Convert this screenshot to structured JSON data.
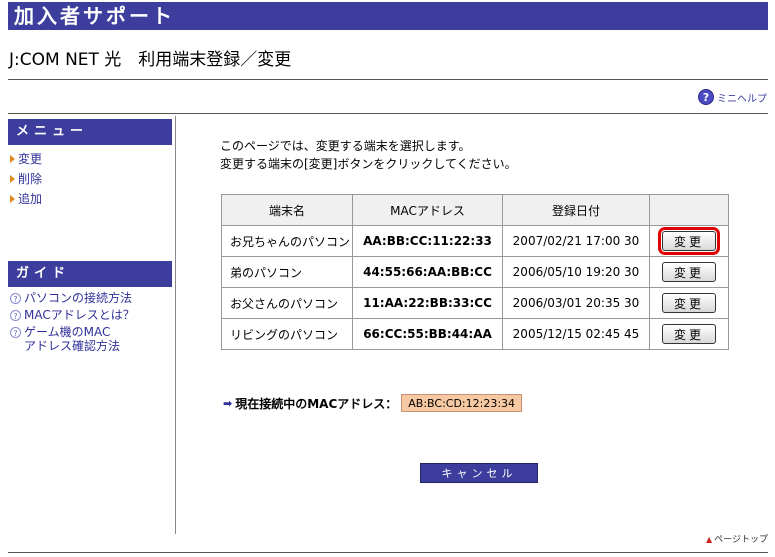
{
  "header": {
    "title": "加入者サポート"
  },
  "page_title": "J:COM NET 光　利用端末登録／変更",
  "mini_help": {
    "label": "ミニヘルプ"
  },
  "sidebar": {
    "menu_title": "メニュー",
    "menu_items": [
      "変更",
      "削除",
      "追加"
    ],
    "guide_title": "ガイド",
    "guide_items": [
      "パソコンの接続方法",
      "MACアドレスとは？",
      "ゲーム機のMAC\nアドレス確認方法"
    ]
  },
  "intro": {
    "line1": "このページでは、変更する端末を選択します。",
    "line2": "変更する端末の[変更]ボタンをクリックしてください。"
  },
  "table": {
    "headers": [
      "端末名",
      "MACアドレス",
      "登録日付",
      ""
    ],
    "rows": [
      {
        "name": "お兄ちゃんのパソコン",
        "mac": "AA:BB:CC:11:22:33",
        "date": "2007/02/21 17:00 30",
        "action": "変更"
      },
      {
        "name": "弟のパソコン",
        "mac": "44:55:66:AA:BB:CC",
        "date": "2006/05/10 19:20 30",
        "action": "変更"
      },
      {
        "name": "お父さんのパソコン",
        "mac": "11:AA:22:BB:33:CC",
        "date": "2006/03/01 20:35 30",
        "action": "変更"
      },
      {
        "name": "リビングのパソコン",
        "mac": "66:CC:55:BB:44:AA",
        "date": "2005/12/15 02:45 45",
        "action": "変更"
      }
    ]
  },
  "current_mac": {
    "label": "現在接続中のMACアドレス：",
    "value": "AB:BC:CD:12:23:34"
  },
  "cancel_label": "キャンセル",
  "page_top_label": "ページトップ",
  "colors": {
    "brand": "#3d3d9d",
    "highlight": "#e00000",
    "mac_box": "#f7c9a2"
  }
}
